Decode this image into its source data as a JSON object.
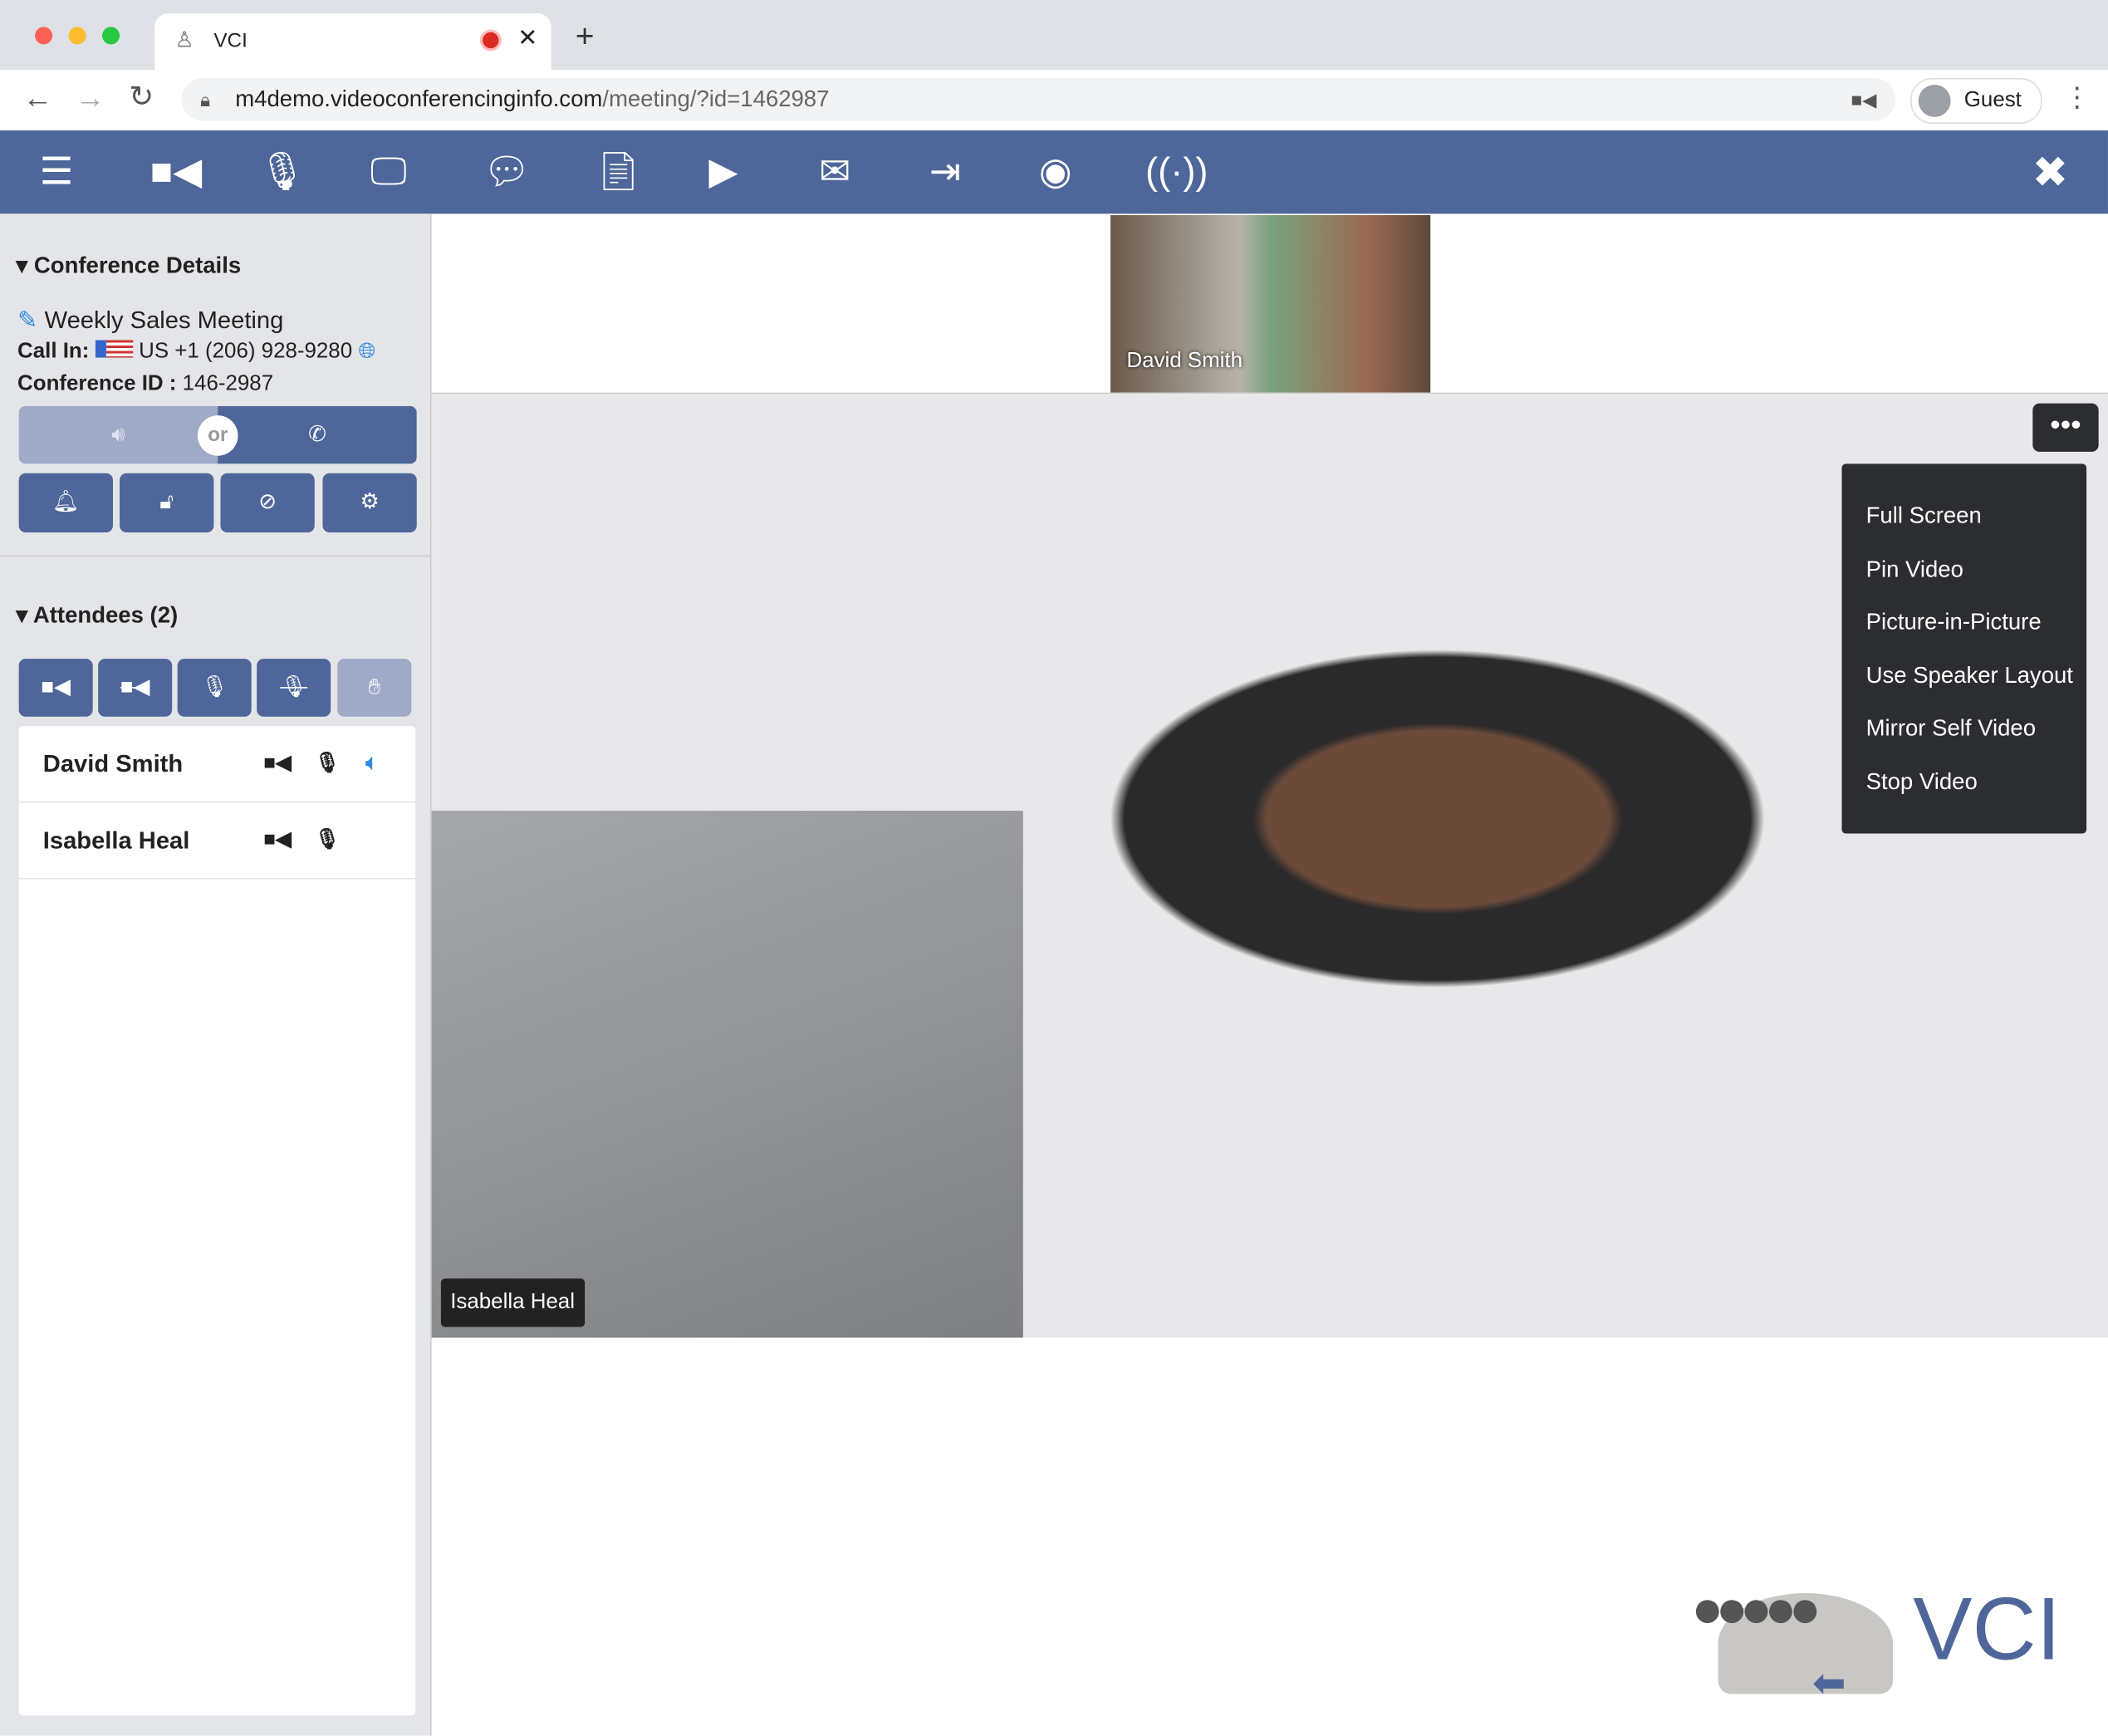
{
  "browser": {
    "tab_title": "VCI",
    "url_host": "m4demo.videoconferencinginfo.com",
    "url_path": "/meeting/?id=1462987",
    "profile": "Guest"
  },
  "toolbar": {
    "icons": [
      "menu-icon",
      "video-camera-icon",
      "microphone-icon",
      "screen-share-icon",
      "chat-icon",
      "document-icon",
      "media-playlist-icon",
      "envelope-icon",
      "exit-door-icon",
      "record-icon",
      "broadcast-icon",
      "close-icon"
    ]
  },
  "sidebar": {
    "conference_header": "Conference Details",
    "meeting_title": "Weekly Sales Meeting",
    "call_in_label": "Call In:",
    "call_in_number": "US +1 (206) 928-9280",
    "conference_id_label": "Conference ID :",
    "conference_id": "146-2987",
    "or_label": "or",
    "attendees_header": "Attendees (2)",
    "attendees": [
      {
        "name": "David Smith",
        "speaking": true
      },
      {
        "name": "Isabella Heal",
        "speaking": false
      }
    ]
  },
  "video": {
    "thumbnail_name": "David Smith",
    "main_name": "Isabella Heal"
  },
  "menu": {
    "items": [
      "Full Screen",
      "Pin Video",
      "Picture-in-Picture",
      "Use Speaker Layout",
      "Mirror Self Video",
      "Stop Video"
    ]
  },
  "logo": {
    "text": "VCI"
  },
  "colors": {
    "toolbar": "#4e6699",
    "accent": "#2f8ae0",
    "menu": "#2b2d30"
  }
}
